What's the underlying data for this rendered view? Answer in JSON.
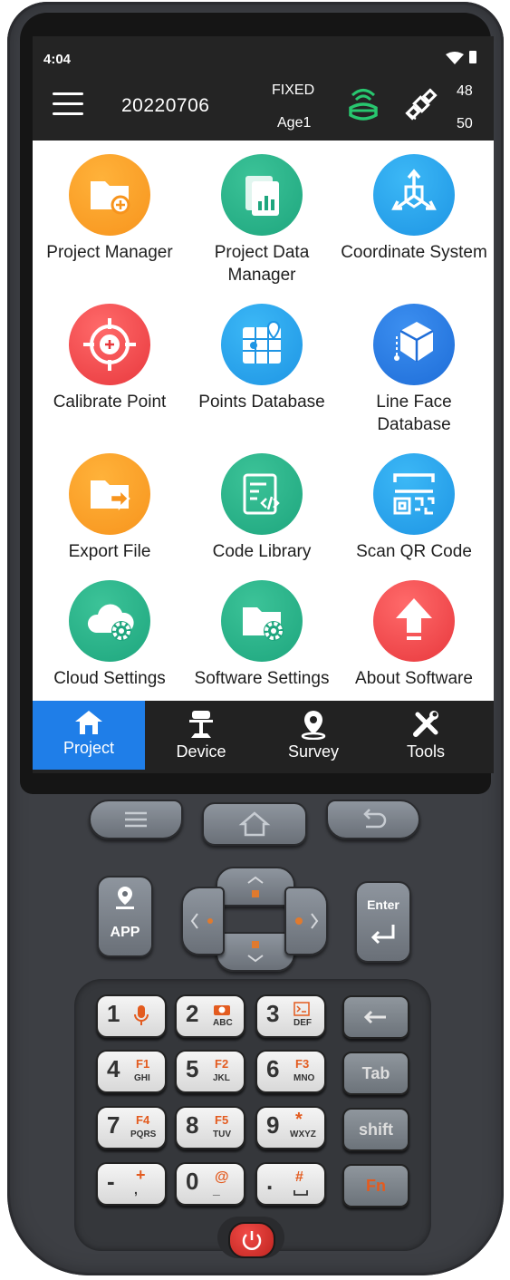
{
  "status_bar": {
    "time": "4:04",
    "project_name": "20220706",
    "solution": "FIXED",
    "age": "Age1",
    "sats_used": "48",
    "sats_visible": "50",
    "gnss_color": "#28c76f"
  },
  "tiles": [
    {
      "label": "Project Manager",
      "icon": "folder-add-icon",
      "color": "orange"
    },
    {
      "label": "Project Data Manager",
      "icon": "data-chart-icon",
      "color": "green"
    },
    {
      "label": "Coordinate System",
      "icon": "axes-icon",
      "color": "blue"
    },
    {
      "label": "Calibrate Point",
      "icon": "crosshair-icon",
      "color": "red"
    },
    {
      "label": "Points Database",
      "icon": "map-pin-grid-icon",
      "color": "blue"
    },
    {
      "label": "Line Face Database",
      "icon": "cube-icon",
      "color": "navy"
    },
    {
      "label": "Export File",
      "icon": "folder-export-icon",
      "color": "orange"
    },
    {
      "label": "Code Library",
      "icon": "code-doc-icon",
      "color": "green"
    },
    {
      "label": "Scan QR Code",
      "icon": "qr-scan-icon",
      "color": "blue"
    },
    {
      "label": "Cloud Settings",
      "icon": "cloud-gear-icon",
      "color": "green"
    },
    {
      "label": "Software Settings",
      "icon": "folder-gear-icon",
      "color": "green"
    },
    {
      "label": "About Software",
      "icon": "arrow-up-icon",
      "color": "red"
    }
  ],
  "nav": [
    {
      "label": "Project",
      "icon": "home-icon",
      "active": true
    },
    {
      "label": "Device",
      "icon": "rover-pole-icon",
      "active": false
    },
    {
      "label": "Survey",
      "icon": "location-pin-icon",
      "active": false
    },
    {
      "label": "Tools",
      "icon": "tools-icon",
      "active": false
    }
  ],
  "hardware": {
    "app_key": "APP",
    "enter_key": "Enter",
    "tab_key": "Tab",
    "shift_key": "shift",
    "fn_key": "Fn",
    "keys": [
      {
        "main": "1",
        "sub": ""
      },
      {
        "main": "2",
        "sub": "ABC"
      },
      {
        "main": "3",
        "sub": "DEF"
      },
      {
        "main": "4",
        "sub": "GHI",
        "fn": "F1"
      },
      {
        "main": "5",
        "sub": "JKL",
        "fn": "F2"
      },
      {
        "main": "6",
        "sub": "MNO",
        "fn": "F3"
      },
      {
        "main": "7",
        "sub": "PQRS",
        "fn": "F4"
      },
      {
        "main": "8",
        "sub": "TUV",
        "fn": "F5"
      },
      {
        "main": "9",
        "sub": "WXYZ",
        "fn": "*"
      },
      {
        "main": "-",
        "sub": ",",
        "fn": "+"
      },
      {
        "main": "0",
        "sub": "_",
        "fn": "@"
      },
      {
        "main": ".",
        "sub": "",
        "fn": "#"
      }
    ]
  }
}
